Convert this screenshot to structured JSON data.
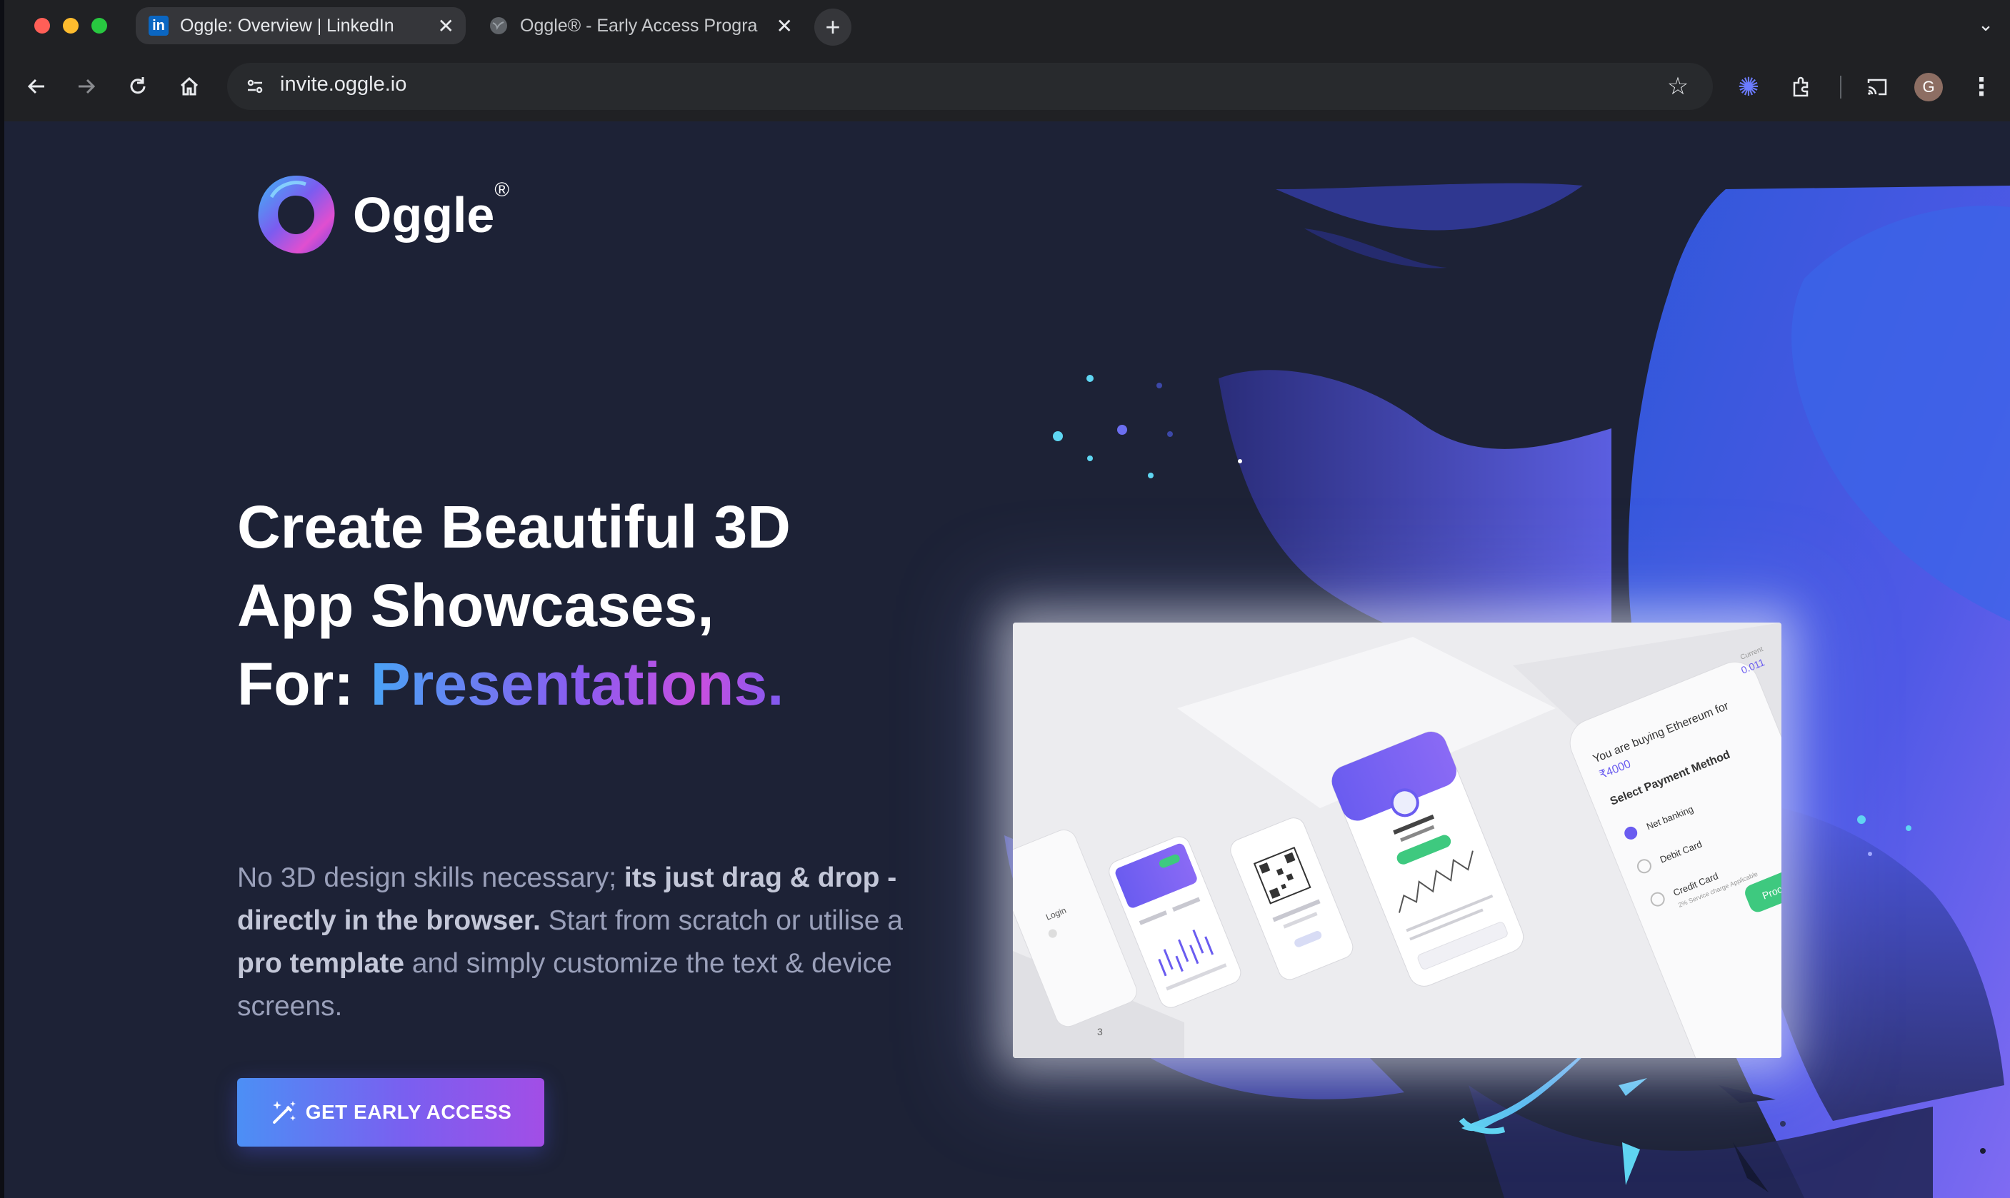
{
  "browser": {
    "tabs": [
      {
        "title": "Oggle: Overview | LinkedIn",
        "active": true
      },
      {
        "title": "Oggle® - Early Access Progra",
        "active": false
      }
    ],
    "url": "invite.oggle.io",
    "profile_initial": "G"
  },
  "brand": {
    "name": "Oggle",
    "registered": "®"
  },
  "hero": {
    "line1": "Create Beautiful 3D",
    "line2": "App Showcases,",
    "line3_prefix": "For:",
    "line3_highlight": "Presentations.",
    "desc_1": "No 3D design skills necessary; ",
    "desc_2": "its just drag & drop - directly in the browser.",
    "desc_3": " Start from scratch or utilise a ",
    "desc_4": "pro template",
    "desc_5": " and simply customize the text & device screens."
  },
  "cta": {
    "label": "GET EARLY ACCESS"
  },
  "mockup": {
    "buying": "You are buying Ethereum for",
    "amount": "₹4000",
    "select_method": "Select Payment Method",
    "methods": [
      "Net banking",
      "Debit Card",
      "Credit Card"
    ],
    "fee_note": "2% Service charge Applicable",
    "proceed": "Proce",
    "current_label": "Current",
    "current_value": "0.011",
    "login": "Login",
    "page_num": "3"
  },
  "colors": {
    "page_bg": "#1d2236",
    "chrome_bg": "#202124",
    "accent_blue": "#4c8ff5",
    "accent_purple": "#a24ee6",
    "green": "#3ec97f"
  }
}
